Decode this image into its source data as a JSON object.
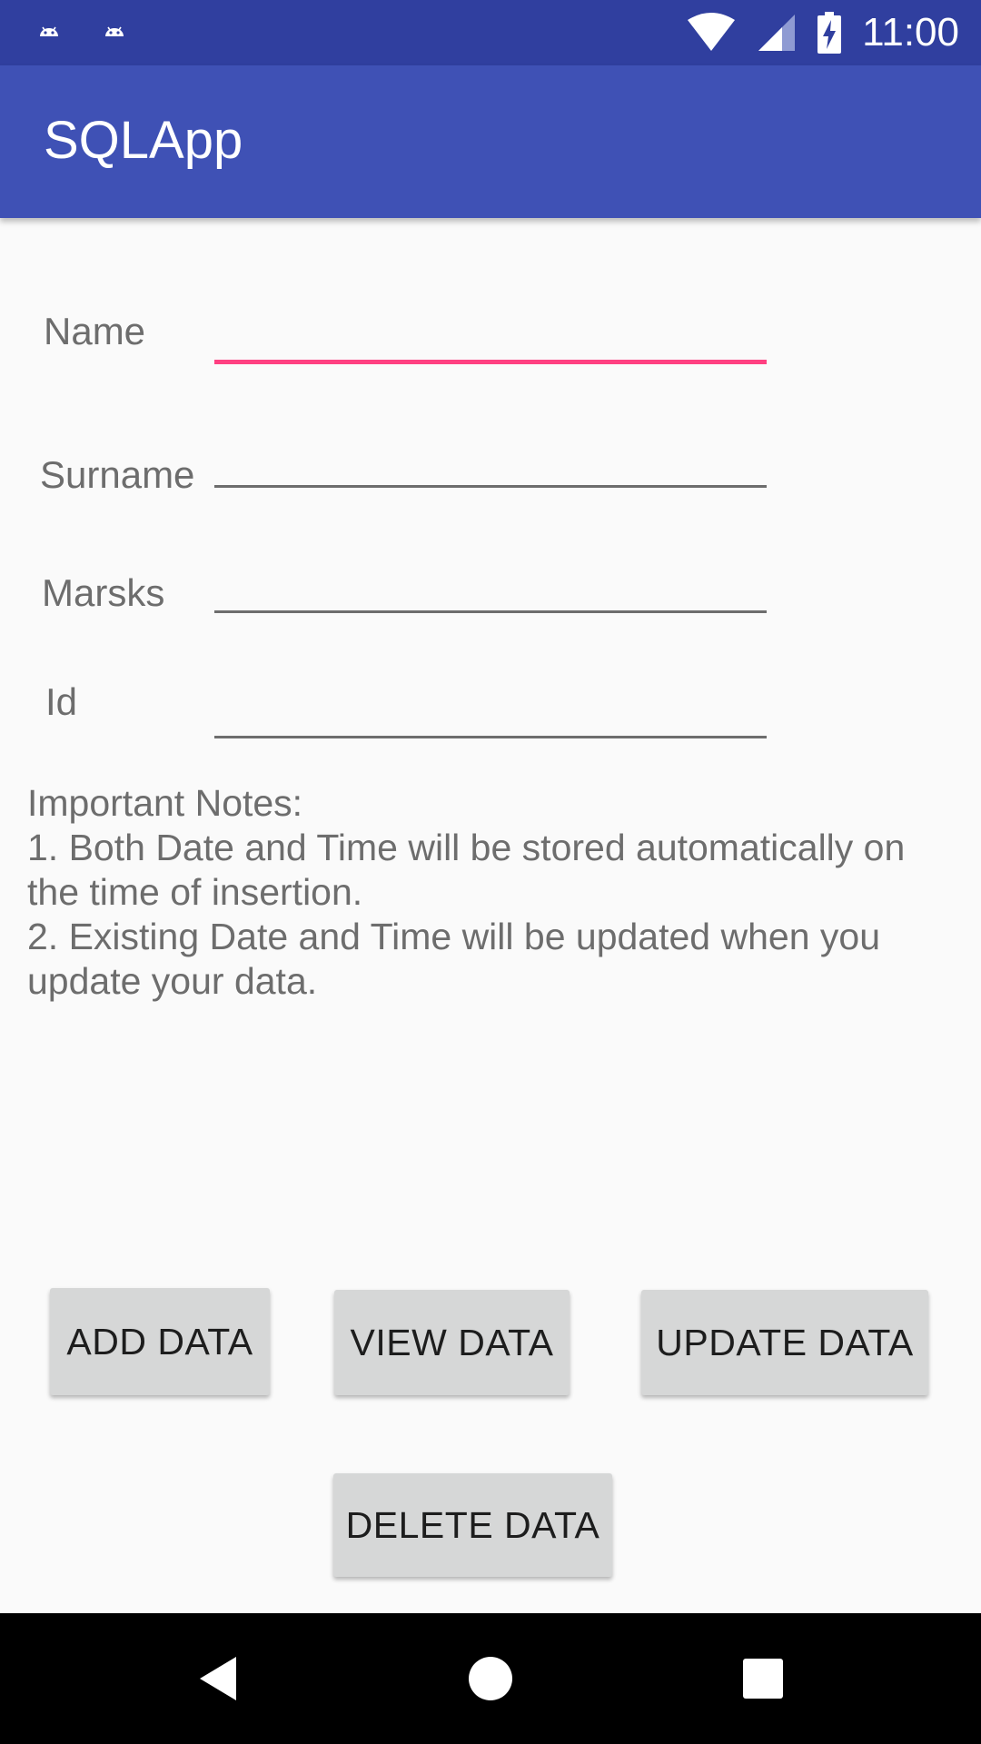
{
  "status_bar": {
    "time": "11:00",
    "notification_icons": [
      "android-notification-icon",
      "android-notification-icon"
    ],
    "icons": [
      "wifi-icon",
      "signal-icon",
      "battery-charging-icon"
    ],
    "background_color": "#303f9f"
  },
  "app_bar": {
    "title": "SQLApp",
    "background_color": "#3f51b5"
  },
  "form": {
    "name": {
      "label": "Name",
      "value": "",
      "focused": true
    },
    "surname": {
      "label": "Surname",
      "value": ""
    },
    "marks": {
      "label": "Marsks",
      "value": ""
    },
    "id": {
      "label": "Id",
      "value": ""
    },
    "focus_color": "#ff4081"
  },
  "notes": {
    "title": "Important Notes:",
    "line1": "1. Both Date and Time will be stored automatically on the time of insertion.",
    "line2": "2. Existing Date and Time will be updated when you update your data."
  },
  "buttons": {
    "add": "ADD DATA",
    "view": "VIEW DATA",
    "update": "UPDATE DATA",
    "delete": "DELETE DATA"
  },
  "nav_bar": {
    "items": [
      "back-icon",
      "home-icon",
      "recents-icon"
    ]
  }
}
